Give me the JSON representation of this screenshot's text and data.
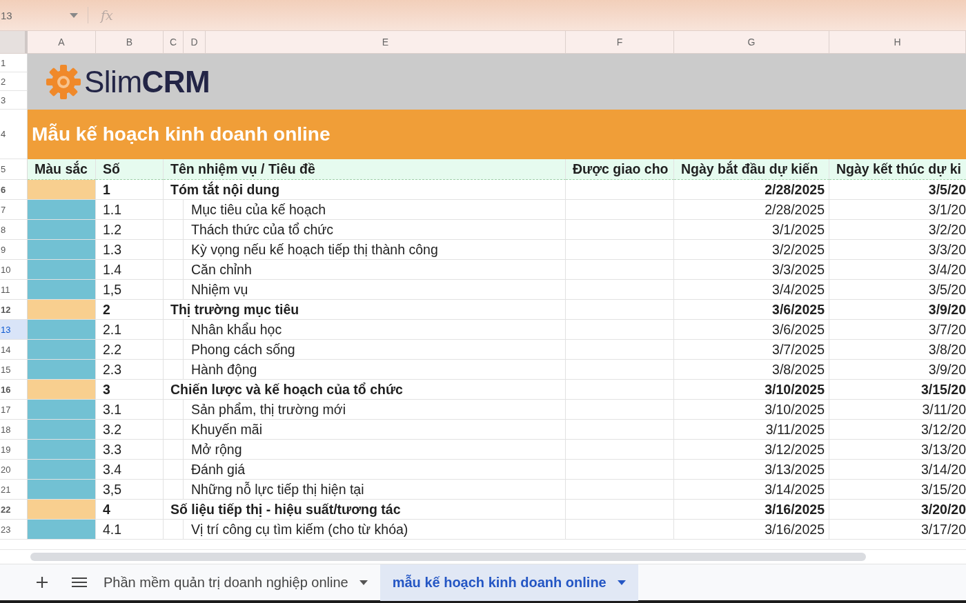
{
  "toolbar": {
    "name_box": "13",
    "formula_label": "fx"
  },
  "columns": [
    "A",
    "B",
    "C",
    "D",
    "E",
    "F",
    "G",
    "H"
  ],
  "banner": {
    "row_numbers": [
      "1",
      "2",
      "3"
    ],
    "logo": "Slim**CRM**"
  },
  "title_row": {
    "row_number": "4",
    "text": "Mẫu kế hoạch kinh doanh online"
  },
  "header_row": {
    "row_number": "5",
    "cells": [
      "Màu sắc",
      "Số",
      "Tên nhiệm vụ / Tiêu đề",
      "Được giao cho",
      "Ngày bắt đầu dự kiến",
      "Ngày kết thúc dự ki"
    ]
  },
  "rows": [
    {
      "row_number": "6",
      "selected": false,
      "kind": "section",
      "color": "#f8cf8f",
      "number": "1",
      "title": "Tóm tắt nội dung",
      "start": "2/28/2025",
      "end": "3/5/20"
    },
    {
      "row_number": "7",
      "selected": false,
      "kind": "item",
      "color": "#72c1d3",
      "number": "1.1",
      "title": "Mục tiêu của kế hoạch",
      "start": "2/28/2025",
      "end": "3/1/20"
    },
    {
      "row_number": "8",
      "selected": false,
      "kind": "item",
      "color": "#72c1d3",
      "number": "1.2",
      "title": "Thách thức của tổ chức",
      "start": "3/1/2025",
      "end": "3/2/20"
    },
    {
      "row_number": "9",
      "selected": false,
      "kind": "item",
      "color": "#72c1d3",
      "number": "1.3",
      "title": "Kỳ vọng nếu kế hoạch tiếp thị thành công",
      "start": "3/2/2025",
      "end": "3/3/20"
    },
    {
      "row_number": "10",
      "selected": false,
      "kind": "item",
      "color": "#72c1d3",
      "number": "1.4",
      "title": "Căn chỉnh",
      "start": "3/3/2025",
      "end": "3/4/20"
    },
    {
      "row_number": "11",
      "selected": false,
      "kind": "item",
      "color": "#72c1d3",
      "number": "1,5",
      "title": "Nhiệm vụ",
      "start": "3/4/2025",
      "end": "3/5/20"
    },
    {
      "row_number": "12",
      "selected": false,
      "kind": "section",
      "color": "#f8cf8f",
      "number": "2",
      "title": "Thị trường mục tiêu",
      "start": "3/6/2025",
      "end": "3/9/20"
    },
    {
      "row_number": "13",
      "selected": true,
      "kind": "item",
      "color": "#72c1d3",
      "number": "2.1",
      "title": "Nhân khẩu học",
      "start": "3/6/2025",
      "end": "3/7/20"
    },
    {
      "row_number": "14",
      "selected": false,
      "kind": "item",
      "color": "#72c1d3",
      "number": "2.2",
      "title": "Phong cách sống",
      "start": "3/7/2025",
      "end": "3/8/20"
    },
    {
      "row_number": "15",
      "selected": false,
      "kind": "item",
      "color": "#72c1d3",
      "number": "2.3",
      "title": "Hành động",
      "start": "3/8/2025",
      "end": "3/9/20"
    },
    {
      "row_number": "16",
      "selected": false,
      "kind": "section",
      "color": "#f8cf8f",
      "number": "3",
      "title": "Chiến lược và kế hoạch của tổ chức",
      "start": "3/10/2025",
      "end": "3/15/20"
    },
    {
      "row_number": "17",
      "selected": false,
      "kind": "item",
      "color": "#72c1d3",
      "number": "3.1",
      "title": "Sản phẩm, thị trường mới",
      "start": "3/10/2025",
      "end": "3/11/20"
    },
    {
      "row_number": "18",
      "selected": false,
      "kind": "item",
      "color": "#72c1d3",
      "number": "3.2",
      "title": "Khuyến mãi",
      "start": "3/11/2025",
      "end": "3/12/20"
    },
    {
      "row_number": "19",
      "selected": false,
      "kind": "item",
      "color": "#72c1d3",
      "number": "3.3",
      "title": "Mở rộng",
      "start": "3/12/2025",
      "end": "3/13/20"
    },
    {
      "row_number": "20",
      "selected": false,
      "kind": "item",
      "color": "#72c1d3",
      "number": "3.4",
      "title": "Đánh giá",
      "start": "3/13/2025",
      "end": "3/14/20"
    },
    {
      "row_number": "21",
      "selected": false,
      "kind": "item",
      "color": "#72c1d3",
      "number": "3,5",
      "title": "Những nỗ lực tiếp thị hiện tại",
      "start": "3/14/2025",
      "end": "3/15/20"
    },
    {
      "row_number": "22",
      "selected": false,
      "kind": "section",
      "color": "#f8cf8f",
      "number": "4",
      "title": "Số liệu tiếp thị - hiệu suất/tương tác",
      "start": "3/16/2025",
      "end": "3/20/20"
    },
    {
      "row_number": "23",
      "selected": false,
      "kind": "item",
      "color": "#72c1d3",
      "number": "4.1",
      "title": "Vị trí công cụ tìm kiếm (cho từ khóa)",
      "start": "3/16/2025",
      "end": "3/17/20"
    }
  ],
  "sheet_tabs": [
    {
      "label": "Phần mềm quản trị doanh nghiệp online",
      "selected": false
    },
    {
      "label": "mẫu kế hoạch kinh doanh online",
      "selected": true
    }
  ]
}
